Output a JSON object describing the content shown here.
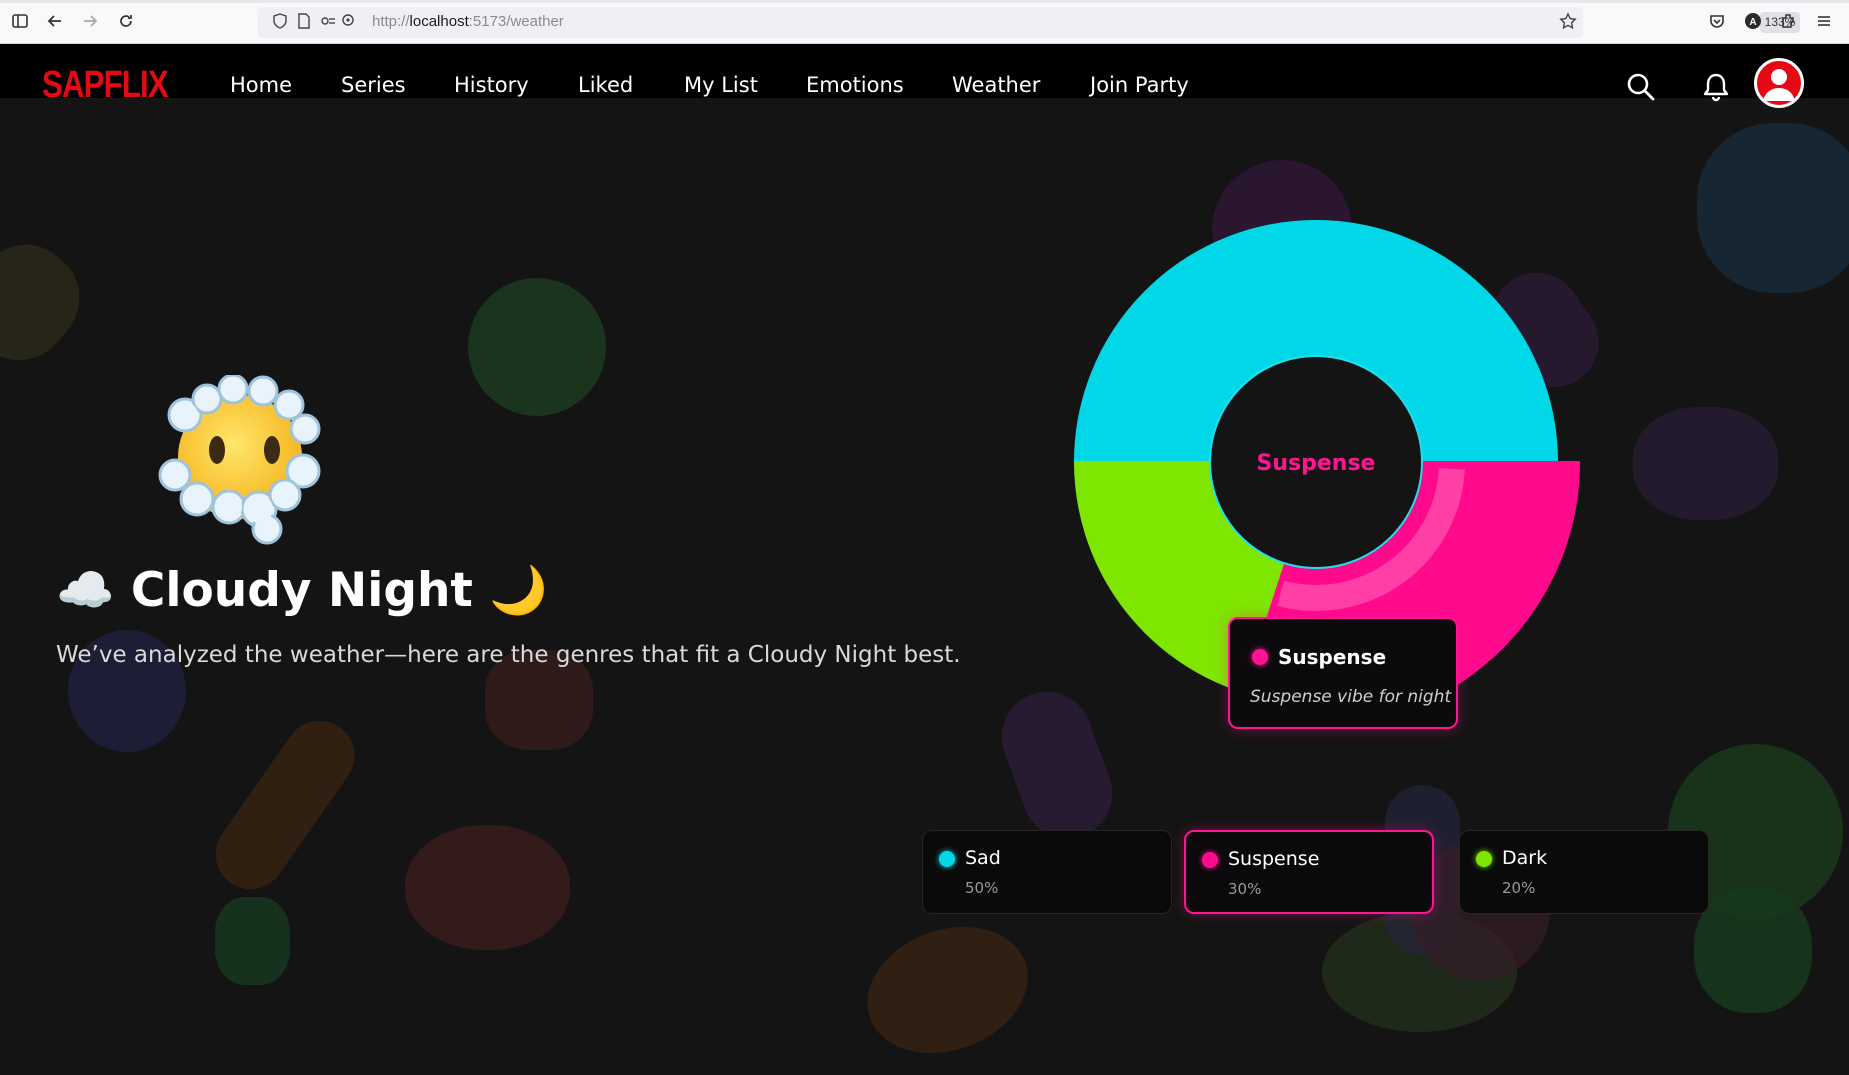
{
  "browser": {
    "url_prefix": "http://",
    "url_host": "localhost",
    "url_rest": ":5173/weather",
    "zoom": "133%"
  },
  "nav": {
    "logo": "SAPFLIX",
    "items": [
      {
        "label": "Home"
      },
      {
        "label": "Series"
      },
      {
        "label": "History"
      },
      {
        "label": "Liked"
      },
      {
        "label": "My List"
      },
      {
        "label": "Emotions"
      },
      {
        "label": "Weather"
      },
      {
        "label": "Join Party"
      }
    ],
    "icons": [
      "search-icon",
      "bell-icon",
      "avatar"
    ]
  },
  "hero": {
    "title": "☁️ Cloudy Night 🌙",
    "subtitle": "We’ve analyzed the weather—here are the genres that fit a Cloudy Night best.",
    "emoji": "face-in-clouds"
  },
  "chart_data": {
    "type": "pie",
    "variant": "donut",
    "center_label": "Suspense",
    "highlighted": "Suspense",
    "series": [
      {
        "name": "Sad",
        "value": 50,
        "color": "#00d8e8"
      },
      {
        "name": "Suspense",
        "value": 30,
        "color": "#ff0a8c"
      },
      {
        "name": "Dark",
        "value": 20,
        "color": "#7ee600"
      }
    ]
  },
  "tooltip": {
    "title": "Suspense",
    "description": "Suspense vibe for night",
    "color": "#ff1493"
  },
  "legend": [
    {
      "name": "Sad",
      "percent": "50%",
      "color": "#00d8e8"
    },
    {
      "name": "Suspense",
      "percent": "30%",
      "color": "#ff0a8c",
      "active": true
    },
    {
      "name": "Dark",
      "percent": "20%",
      "color": "#7ee600"
    }
  ],
  "colors": {
    "brand": "#e50914",
    "background": "#141414",
    "accent": "#ff1493"
  }
}
